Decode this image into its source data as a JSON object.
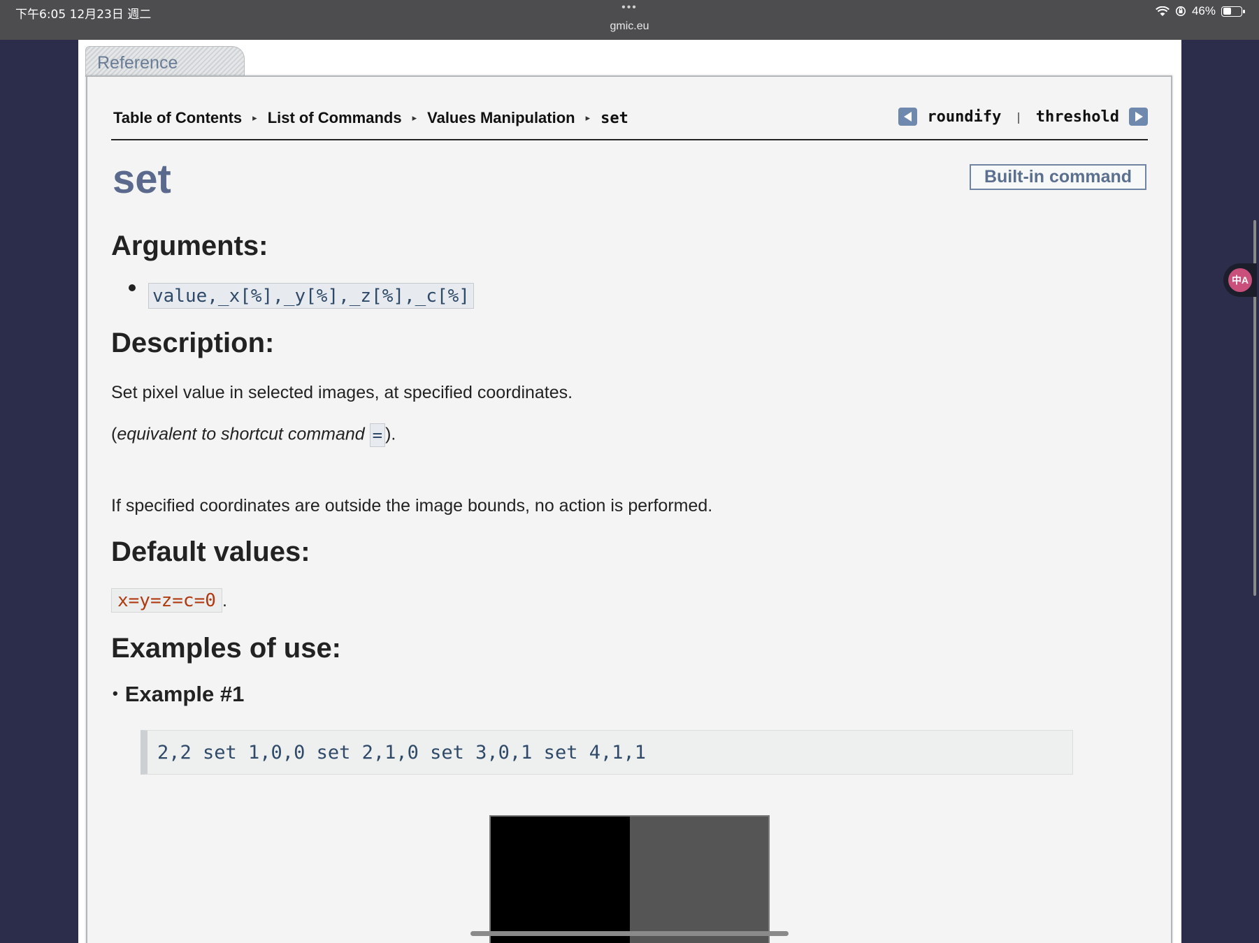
{
  "status_bar": {
    "time": "下午6:05 12月23日 週二",
    "dots": "•••",
    "url": "gmic.eu",
    "battery": "46%",
    "battery_level": 0.46
  },
  "tab": {
    "label": "Reference"
  },
  "breadcrumb": {
    "items": [
      "Table of Contents",
      "List of Commands",
      "Values Manipulation"
    ],
    "current": "set",
    "separator": "▸"
  },
  "nav": {
    "prev": "roundify",
    "separator": "|",
    "next": "threshold"
  },
  "page": {
    "title": "set",
    "badge": "Built-in command"
  },
  "sections": {
    "arguments_heading": "Arguments:",
    "argument": "value,_x[%],_y[%],_z[%],_c[%]",
    "description_heading": "Description:",
    "description_line1": "Set pixel value in selected images, at specified coordinates.",
    "equivalent_open": "(",
    "equivalent_text": "equivalent to shortcut command",
    "equivalent_code": "=",
    "equivalent_close": ").",
    "description_line3": "If specified coordinates are outside the image bounds, no action is performed.",
    "defaults_heading": "Default values:",
    "defaults_code": "x=y=z=c=0",
    "defaults_period": ".",
    "examples_heading": "Examples of use:",
    "example_bullet": "•",
    "example_title": "Example #1",
    "example_code": "2,2 set 1,0,0 set 2,1,0 set 3,0,1 set 4,1,1"
  },
  "preview_colors": [
    "#000000",
    "#555555"
  ],
  "translate_widget": {
    "label": "中A"
  }
}
